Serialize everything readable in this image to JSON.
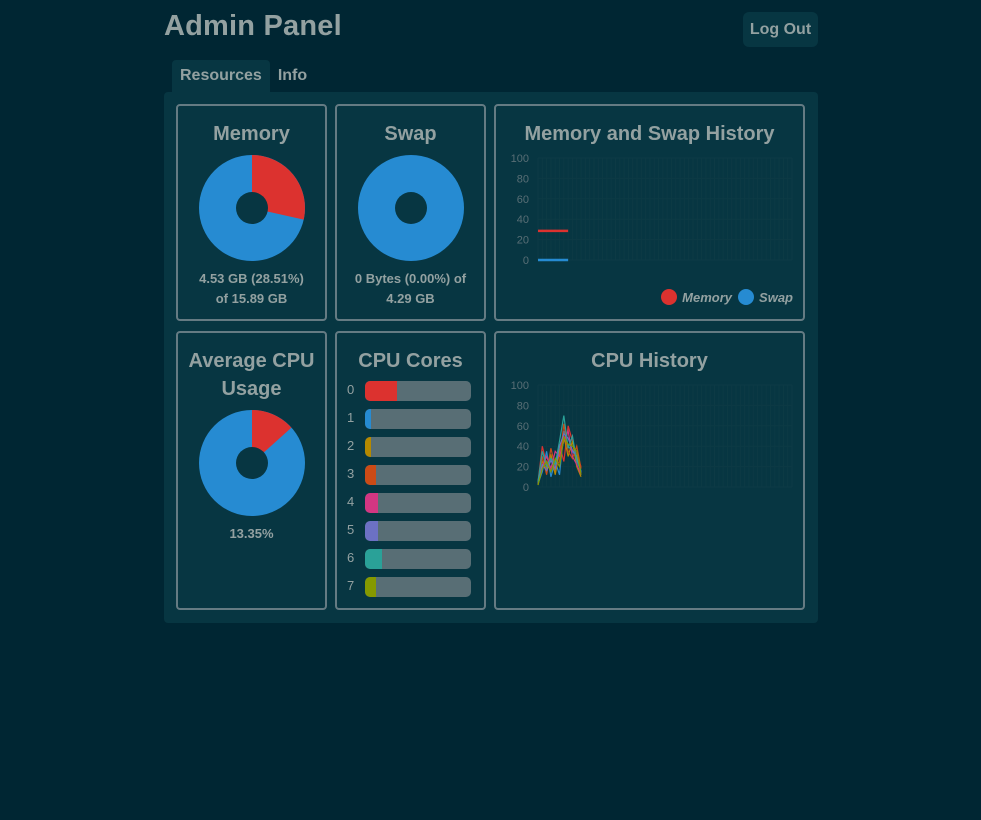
{
  "header": {
    "title": "Admin Panel",
    "logout_label": "Log Out"
  },
  "tabs": [
    {
      "label": "Resources",
      "active": true
    },
    {
      "label": "Info",
      "active": false
    }
  ],
  "colors": {
    "used": "#dc322f",
    "free": "#268bd2",
    "hole": "#073642"
  },
  "memory": {
    "title": "Memory",
    "percent": 28.51,
    "line1": "4.53 GB (28.51%)",
    "line2": "of 15.89 GB"
  },
  "swap": {
    "title": "Swap",
    "percent": 0.0,
    "line1": "0 Bytes (0.00%) of",
    "line2": "4.29 GB"
  },
  "avg_cpu": {
    "title_line1": "Average CPU",
    "title_line2": "Usage",
    "percent": 13.35,
    "label": "13.35%"
  },
  "cpu_cores": {
    "title": "CPU Cores",
    "cores": [
      {
        "label": "0",
        "usage": 0.3,
        "color": "#dc322f"
      },
      {
        "label": "1",
        "usage": 0.06,
        "color": "#268bd2"
      },
      {
        "label": "2",
        "usage": 0.06,
        "color": "#b58900"
      },
      {
        "label": "3",
        "usage": 0.1,
        "color": "#cb4b16"
      },
      {
        "label": "4",
        "usage": 0.12,
        "color": "#d33682"
      },
      {
        "label": "5",
        "usage": 0.12,
        "color": "#6c71c4"
      },
      {
        "label": "6",
        "usage": 0.16,
        "color": "#2aa198"
      },
      {
        "label": "7",
        "usage": 0.1,
        "color": "#859900"
      }
    ]
  },
  "mem_history": {
    "title": "Memory and Swap History",
    "legend": [
      {
        "name": "Memory",
        "color": "#dc322f"
      },
      {
        "name": "Swap",
        "color": "#268bd2"
      }
    ]
  },
  "cpu_history": {
    "title": "CPU History"
  },
  "chart_data": [
    {
      "type": "line",
      "title": "Memory and Swap History",
      "ylim": [
        0,
        100
      ],
      "yticks": [
        "100",
        "80",
        "60",
        "40",
        "20",
        "0"
      ],
      "grid": true,
      "legend_placement": "bottom-right",
      "x_count": 60,
      "series": [
        {
          "name": "Memory",
          "color": "#dc322f",
          "values": [
            28.5,
            28.5,
            28.5,
            28.5,
            28.5,
            28.5,
            28.5,
            28.5
          ]
        },
        {
          "name": "Swap",
          "color": "#268bd2",
          "values": [
            0,
            0,
            0,
            0,
            0,
            0,
            0,
            0
          ]
        }
      ]
    },
    {
      "type": "line",
      "title": "CPU History",
      "ylim": [
        0,
        100
      ],
      "yticks": [
        "100",
        "80",
        "60",
        "40",
        "20",
        "0"
      ],
      "grid": true,
      "x_count": 60,
      "series": [
        {
          "color": "#dc322f",
          "values": [
            5,
            40,
            22,
            30,
            15,
            42,
            25,
            60,
            45,
            30,
            20
          ]
        },
        {
          "color": "#268bd2",
          "values": [
            3,
            15,
            35,
            10,
            25,
            12,
            55,
            40,
            35,
            28,
            15
          ]
        },
        {
          "color": "#b58900",
          "values": [
            2,
            25,
            18,
            32,
            12,
            35,
            50,
            30,
            45,
            20,
            10
          ]
        },
        {
          "color": "#cb4b16",
          "values": [
            4,
            30,
            12,
            38,
            20,
            25,
            62,
            35,
            28,
            40,
            18
          ]
        },
        {
          "color": "#d33682",
          "values": [
            6,
            20,
            30,
            18,
            35,
            30,
            45,
            55,
            30,
            22,
            12
          ]
        },
        {
          "color": "#6c71c4",
          "values": [
            3,
            22,
            16,
            26,
            18,
            40,
            52,
            48,
            36,
            30,
            14
          ]
        },
        {
          "color": "#2aa198",
          "values": [
            5,
            35,
            20,
            28,
            22,
            45,
            70,
            38,
            50,
            25,
            16
          ]
        },
        {
          "color": "#859900",
          "values": [
            2,
            18,
            25,
            15,
            28,
            20,
            48,
            42,
            40,
            35,
            12
          ]
        }
      ]
    }
  ]
}
